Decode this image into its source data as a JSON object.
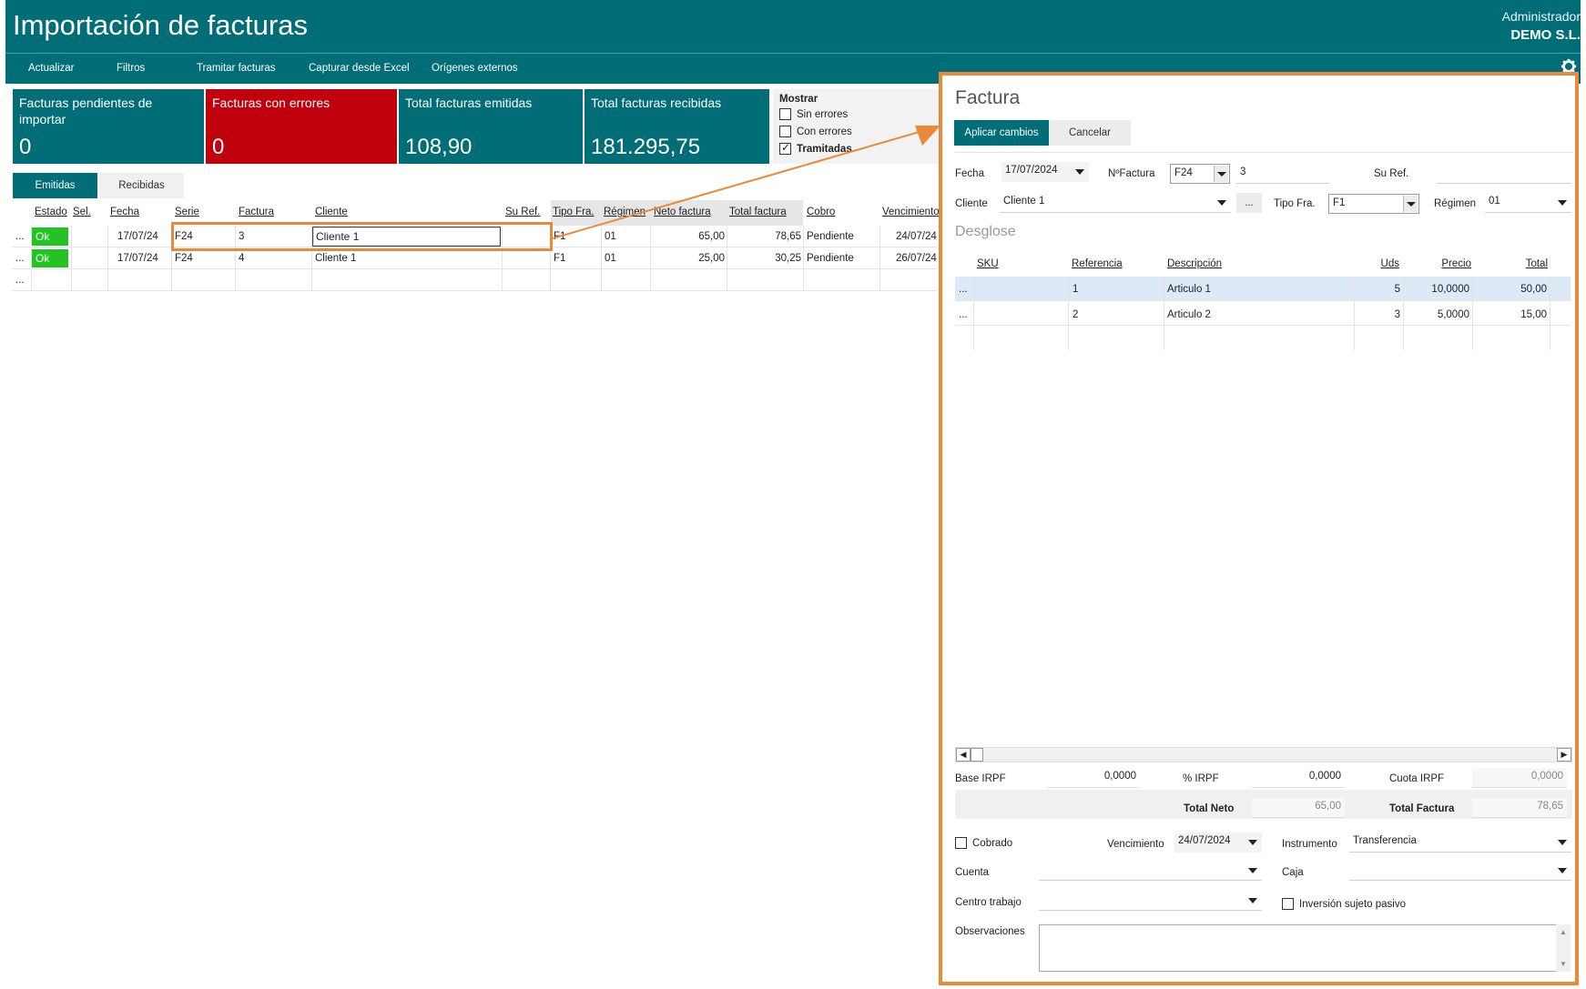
{
  "app": {
    "title": "Importación de facturas",
    "user": "Administrador",
    "company": "DEMO S.L."
  },
  "toolbar": {
    "items": [
      "Actualizar",
      "Filtros",
      "Tramitar facturas",
      "Capturar desde Excel",
      "Orígenes externos"
    ]
  },
  "tiles": [
    {
      "label": "Facturas pendientes de importar",
      "value": "0"
    },
    {
      "label": "Facturas con errores",
      "value": "0"
    },
    {
      "label": "Total facturas emitidas",
      "value": "108,90"
    },
    {
      "label": "Total facturas recibidas",
      "value": "181.295,75"
    }
  ],
  "filters": {
    "title": "Mostrar",
    "options": [
      {
        "label": "Sin errores",
        "checked": false
      },
      {
        "label": "Con errores",
        "checked": false
      },
      {
        "label": "Tramitadas",
        "checked": true
      }
    ]
  },
  "tabs": [
    "Emitidas",
    "Recibidas"
  ],
  "grid": {
    "headers": [
      "Estado",
      "Sel.",
      "Fecha",
      "Serie",
      "Factura",
      "Cliente",
      "Su Ref.",
      "Tipo Fra.",
      "Régimen",
      "Neto factura",
      "Total factura",
      "Cobro",
      "Vencimiento"
    ],
    "rows": [
      {
        "menu": "...",
        "estado": "Ok",
        "fecha": "17/07/24",
        "serie": "F24",
        "factura": "3",
        "cliente": "Cliente 1",
        "tipo": "F1",
        "regimen": "01",
        "neto": "65,00",
        "total": "78,65",
        "cobro": "Pendiente",
        "venc": "24/07/24"
      },
      {
        "menu": "...",
        "estado": "Ok",
        "fecha": "17/07/24",
        "serie": "F24",
        "factura": "4",
        "cliente": "Cliente 1",
        "tipo": "F1",
        "regimen": "01",
        "neto": "25,00",
        "total": "30,25",
        "cobro": "Pendiente",
        "venc": "26/07/24"
      }
    ],
    "new_row_menu": "..."
  },
  "panel": {
    "title": "Factura",
    "apply_label": "Aplicar cambios",
    "cancel_label": "Cancelar",
    "fecha_label": "Fecha",
    "fecha": "17/07/2024",
    "nfactura_label": "NºFactura",
    "serie": "F24",
    "numero": "3",
    "suref_label": "Su Ref.",
    "suref": "",
    "cliente_label": "Cliente",
    "cliente": "Cliente 1",
    "cliente_more": "...",
    "tipofra_label": "Tipo Fra.",
    "tipofra": "F1",
    "regimen_label": "Régimen",
    "regimen": "01",
    "desglose_title": "Desglose",
    "lines_headers": [
      "SKU",
      "Referencia",
      "Descripción",
      "Uds",
      "Precio",
      "Total"
    ],
    "lines": [
      {
        "menu": "...",
        "sku": "",
        "ref": "1",
        "desc": "Articulo 1",
        "uds": "5",
        "precio": "10,0000",
        "total": "50,00"
      },
      {
        "menu": "...",
        "sku": "",
        "ref": "2",
        "desc": "Articulo 2",
        "uds": "3",
        "precio": "5,0000",
        "total": "15,00"
      }
    ],
    "base_irpf_label": "Base IRPF",
    "base_irpf": "0,0000",
    "pct_irpf_label": "% IRPF",
    "pct_irpf": "0,0000",
    "cuota_irpf_label": "Cuota IRPF",
    "cuota_irpf": "0,0000",
    "total_neto_label": "Total Neto",
    "total_neto": "65,00",
    "total_factura_label": "Total Factura",
    "total_factura": "78,65",
    "cobrado_label": "Cobrado",
    "cobrado_checked": false,
    "vencimiento_label": "Vencimiento",
    "vencimiento": "24/07/2024",
    "instrumento_label": "Instrumento",
    "instrumento": "Transferencia",
    "cuenta_label": "Cuenta",
    "cuenta": "",
    "caja_label": "Caja",
    "caja": "",
    "centro_label": "Centro trabajo",
    "centro": "",
    "inversion_label": "Inversión sujeto pasivo",
    "inversion_checked": false,
    "observaciones_label": "Observaciones",
    "observaciones": ""
  },
  "colors": {
    "teal": "#006d77",
    "error_red": "#c0000c",
    "ok_green": "#22c322",
    "highlight_orange": "#e98a3a",
    "selected_row": "#dde9f7"
  }
}
